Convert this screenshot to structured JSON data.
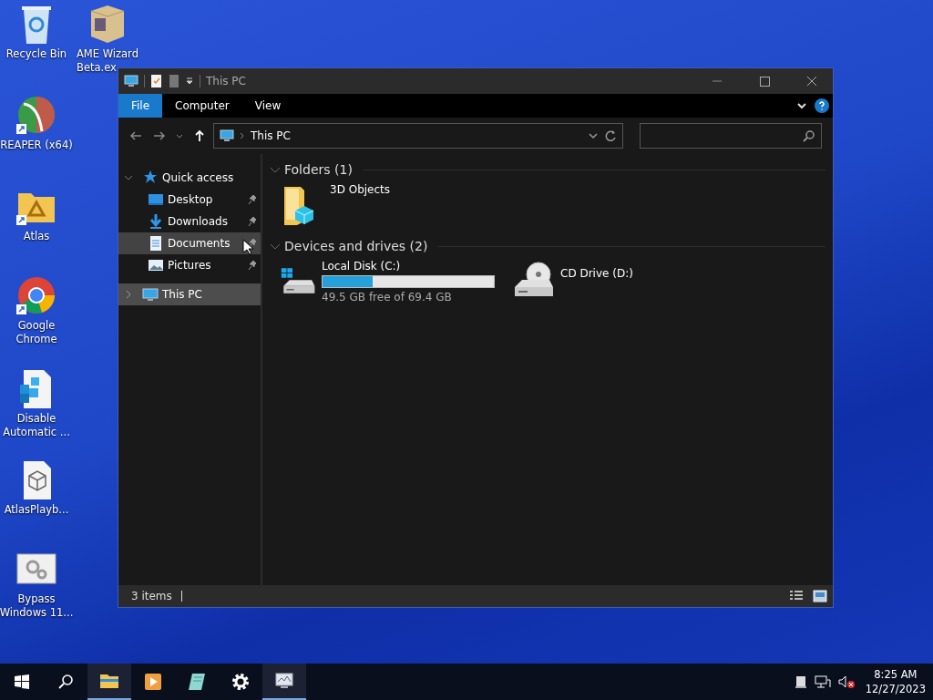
{
  "desktop_icons": [
    {
      "label": "Recycle Bin",
      "kind": "recycle",
      "shortcut": false
    },
    {
      "label": "AME Wizard\nBeta.ex",
      "kind": "box",
      "shortcut": false
    },
    {
      "label": "REAPER (x64)",
      "kind": "reaper",
      "shortcut": true
    },
    {
      "label": "Atlas",
      "kind": "folder",
      "shortcut": true
    },
    {
      "label": "Google\nChrome",
      "kind": "chrome",
      "shortcut": true
    },
    {
      "label": "Disable\nAutomatic ...",
      "kind": "registry",
      "shortcut": false
    },
    {
      "label": "AtlasPlayb...",
      "kind": "cube",
      "shortcut": false
    },
    {
      "label": "Bypass\nWindows 11...",
      "kind": "gears",
      "shortcut": false
    }
  ],
  "window": {
    "title": "This PC",
    "ribbon_tabs": [
      {
        "label": "File",
        "selected": true
      },
      {
        "label": "Computer",
        "selected": false
      },
      {
        "label": "View",
        "selected": false
      }
    ],
    "address": {
      "path": "This PC"
    },
    "nav": [
      {
        "label": "Quick access",
        "kind": "star",
        "expanded": true,
        "selected": false,
        "children": [
          {
            "label": "Desktop",
            "kind": "desktop",
            "pinned": true,
            "hovered": false
          },
          {
            "label": "Downloads",
            "kind": "download",
            "pinned": true,
            "hovered": false
          },
          {
            "label": "Documents",
            "kind": "document",
            "pinned": true,
            "hovered": true
          },
          {
            "label": "Pictures",
            "kind": "pictures",
            "pinned": true,
            "hovered": false
          }
        ]
      },
      {
        "label": "This PC",
        "kind": "pc",
        "expanded": false,
        "selected": true
      }
    ],
    "sections": [
      {
        "title": "Folders (1)",
        "expanded": true,
        "items": [
          {
            "kind": "folder3d",
            "name": "3D Objects"
          }
        ]
      },
      {
        "title": "Devices and drives (2)",
        "expanded": true,
        "items": [
          {
            "kind": "disk",
            "name": "Local Disk (C:)",
            "level": 0.29,
            "detail": "49.5 GB free of 69.4 GB"
          },
          {
            "kind": "cd",
            "name": "CD Drive (D:)"
          }
        ]
      }
    ],
    "status_bar": {
      "count": "3 items"
    }
  },
  "taskbar": {
    "apps": [
      {
        "kind": "explorer",
        "running": true
      },
      {
        "kind": "media",
        "running": false
      },
      {
        "kind": "notepad",
        "running": false
      },
      {
        "kind": "settings",
        "running": false
      },
      {
        "kind": "monitor",
        "running": true
      }
    ],
    "clock": {
      "time": "8:25 AM",
      "date": "12/27/2023"
    }
  }
}
